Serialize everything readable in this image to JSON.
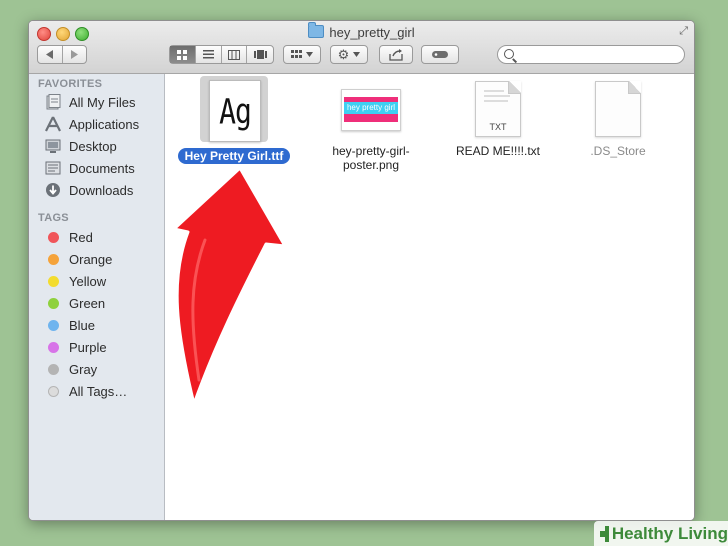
{
  "window": {
    "title": "hey_pretty_girl"
  },
  "toolbar": {
    "view_buttons": [
      "icon-view",
      "list-view",
      "column-view",
      "cover-flow-view"
    ],
    "arrange_icon": "arrange-grid-icon",
    "action_icon": "gear-icon",
    "share_icon": "share-icon",
    "tag_icon": "tag-icon",
    "search": {
      "placeholder": ""
    }
  },
  "sidebar": {
    "favorites_heading": "FAVORITES",
    "favorites": [
      {
        "label": "All My Files",
        "icon": "all-my-files-icon"
      },
      {
        "label": "Applications",
        "icon": "applications-icon"
      },
      {
        "label": "Desktop",
        "icon": "desktop-icon"
      },
      {
        "label": "Documents",
        "icon": "documents-icon"
      },
      {
        "label": "Downloads",
        "icon": "downloads-icon"
      }
    ],
    "tags_heading": "TAGS",
    "tags": [
      {
        "label": "Red",
        "color": "#f0555a"
      },
      {
        "label": "Orange",
        "color": "#f5a33a"
      },
      {
        "label": "Yellow",
        "color": "#f3dc2e"
      },
      {
        "label": "Green",
        "color": "#8fd13d"
      },
      {
        "label": "Blue",
        "color": "#6fb4ee"
      },
      {
        "label": "Purple",
        "color": "#d774e8"
      },
      {
        "label": "Gray",
        "color": "#b4b4b4"
      },
      {
        "label": "All Tags…",
        "color": "#dcdcdc"
      }
    ]
  },
  "files": [
    {
      "name": "Hey Pretty Girl.ttf",
      "selected": true,
      "icon_text": "Ag"
    },
    {
      "name": "hey-pretty-girl-poster.png",
      "line1": "hey-pretty-girl-",
      "line2": "poster.png",
      "icon_text": "hey pretty girl"
    },
    {
      "name": "READ ME!!!!.txt",
      "icon_text": "TXT"
    },
    {
      "name": ".DS_Store"
    }
  ],
  "watermark": {
    "text": "Healthy Living",
    "color": "#3d8a3a"
  }
}
